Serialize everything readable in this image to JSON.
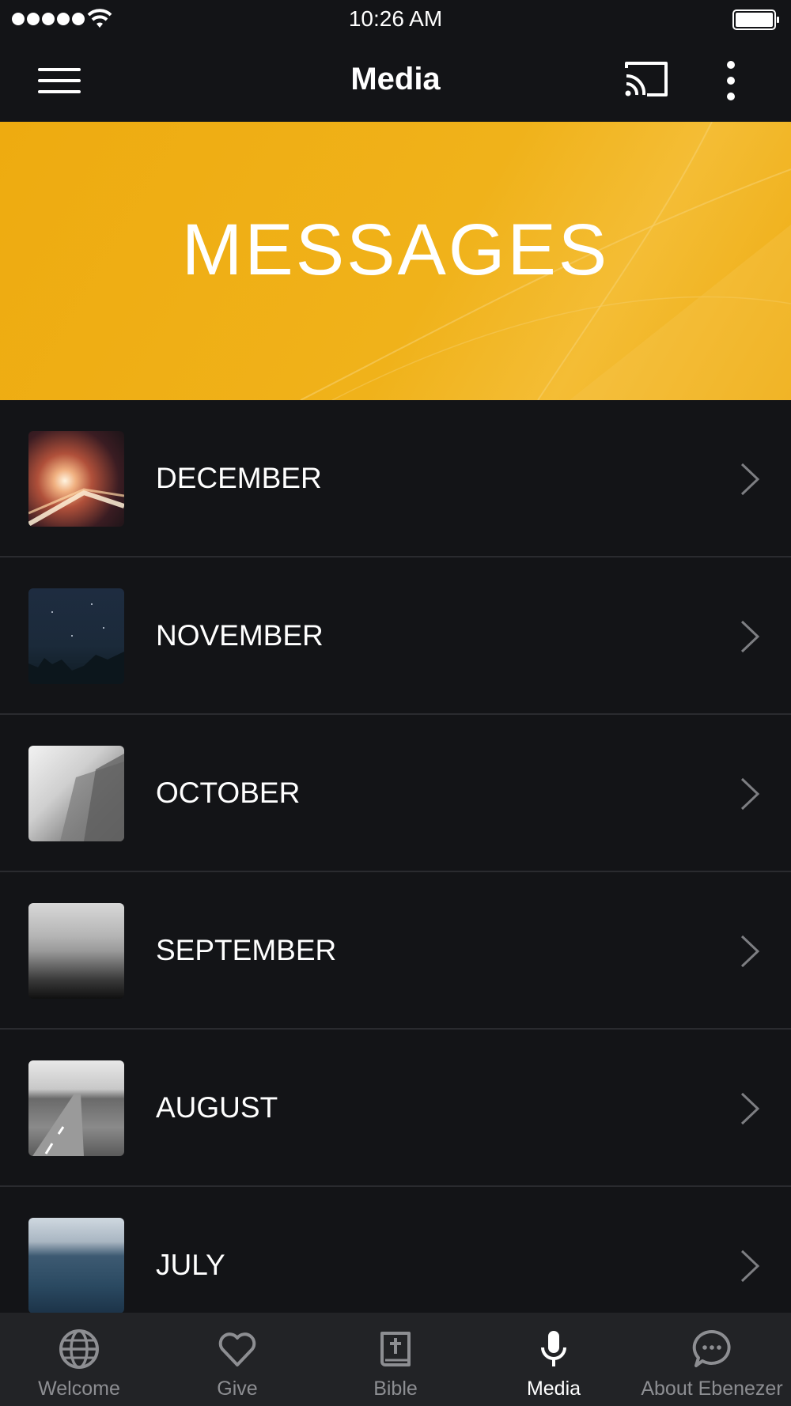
{
  "status_bar": {
    "time": "10:26 AM"
  },
  "nav": {
    "title": "Media"
  },
  "banner": {
    "title": "MESSAGES"
  },
  "list": {
    "items": [
      {
        "label": "DECEMBER"
      },
      {
        "label": "NOVEMBER"
      },
      {
        "label": "OCTOBER"
      },
      {
        "label": "SEPTEMBER"
      },
      {
        "label": "AUGUST"
      },
      {
        "label": "JULY"
      }
    ]
  },
  "tabs": [
    {
      "label": "Welcome",
      "icon": "globe-icon",
      "active": false
    },
    {
      "label": "Give",
      "icon": "heart-icon",
      "active": false
    },
    {
      "label": "Bible",
      "icon": "bible-icon",
      "active": false
    },
    {
      "label": "Media",
      "icon": "microphone-icon",
      "active": true
    },
    {
      "label": "About Ebenezer",
      "icon": "chat-bubble-icon",
      "active": false
    }
  ],
  "colors": {
    "background": "#131417",
    "banner": "#F0B015",
    "tab_bar": "#222326",
    "tab_inactive": "#8D8E92",
    "tab_active": "#FFFFFF"
  }
}
